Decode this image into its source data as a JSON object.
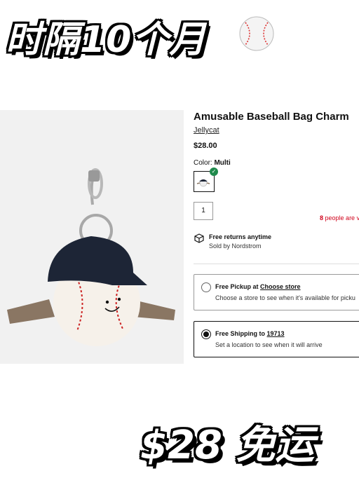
{
  "headline": "时隔10个月",
  "headline_icon": "baseball-emoji-icon",
  "product": {
    "title": "Amusable Baseball Bag Charm",
    "brand": "Jellycat",
    "price": "$28.00",
    "color_label": "Color:",
    "color_value": "Multi",
    "quantity": "1",
    "watching_count": "8",
    "watching_text": "people are vi"
  },
  "returns": {
    "line1": "Free returns anytime",
    "line2": "Sold by Nordstrom"
  },
  "fulfillment": {
    "pickup": {
      "prefix": "Free Pickup at",
      "link": "Choose store",
      "sub": "Choose a store to see when it's available for picku",
      "selected": false
    },
    "shipping": {
      "prefix": "Free Shipping to",
      "link": "19713",
      "sub": "Set a location to see when it will arrive",
      "selected": true
    }
  },
  "bottom_banner": "$28 免运",
  "colors": {
    "accent_red": "#d0021b",
    "check_green": "#1f8a4c"
  }
}
